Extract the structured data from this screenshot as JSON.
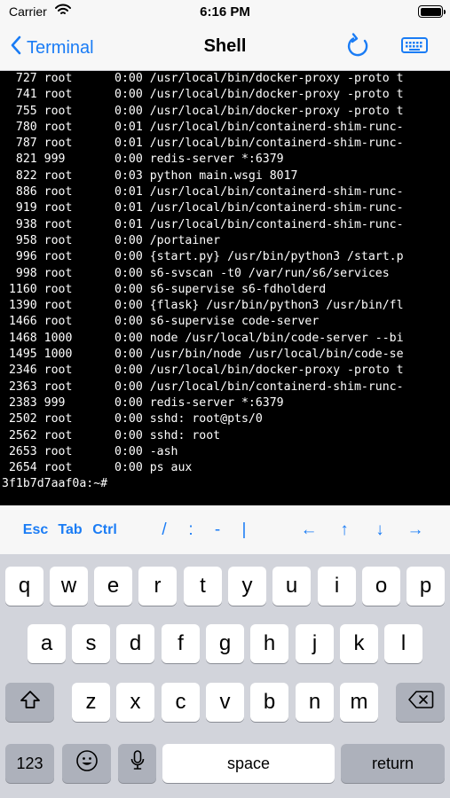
{
  "status_bar": {
    "carrier": "Carrier",
    "time": "6:16 PM"
  },
  "nav": {
    "back_label": "Terminal",
    "title": "Shell"
  },
  "terminal": {
    "lines": [
      "  727 root      0:00 /usr/local/bin/docker-proxy -proto t",
      "  741 root      0:00 /usr/local/bin/docker-proxy -proto t",
      "  755 root      0:00 /usr/local/bin/docker-proxy -proto t",
      "  780 root      0:01 /usr/local/bin/containerd-shim-runc-",
      "  787 root      0:01 /usr/local/bin/containerd-shim-runc-",
      "  821 999       0:00 redis-server *:6379",
      "  822 root      0:03 python main.wsgi 8017",
      "  886 root      0:01 /usr/local/bin/containerd-shim-runc-",
      "  919 root      0:01 /usr/local/bin/containerd-shim-runc-",
      "  938 root      0:01 /usr/local/bin/containerd-shim-runc-",
      "  958 root      0:00 /portainer",
      "  996 root      0:00 {start.py} /usr/bin/python3 /start.p",
      "  998 root      0:00 s6-svscan -t0 /var/run/s6/services",
      " 1160 root      0:00 s6-supervise s6-fdholderd",
      " 1390 root      0:00 {flask} /usr/bin/python3 /usr/bin/fl",
      " 1466 root      0:00 s6-supervise code-server",
      " 1468 1000      0:00 node /usr/local/bin/code-server --bi",
      " 1495 1000      0:00 /usr/bin/node /usr/local/bin/code-se",
      " 2346 root      0:00 /usr/local/bin/docker-proxy -proto t",
      " 2363 root      0:00 /usr/local/bin/containerd-shim-runc-",
      " 2383 999       0:00 redis-server *:6379",
      " 2502 root      0:00 sshd: root@pts/0",
      " 2562 root      0:00 sshd: root",
      " 2653 root      0:00 -ash",
      " 2654 root      0:00 ps aux",
      "3f1b7d7aaf0a:~#"
    ]
  },
  "extra_keys": {
    "esc": "Esc",
    "tab": "Tab",
    "ctrl": "Ctrl",
    "slash": "/",
    "colon": ":",
    "dash": "-",
    "pipe": "|",
    "left": "←",
    "up": "↑",
    "down": "↓",
    "right": "→"
  },
  "keyboard": {
    "row1": [
      "q",
      "w",
      "e",
      "r",
      "t",
      "y",
      "u",
      "i",
      "o",
      "p"
    ],
    "row2": [
      "a",
      "s",
      "d",
      "f",
      "g",
      "h",
      "j",
      "k",
      "l"
    ],
    "row3": [
      "z",
      "x",
      "c",
      "v",
      "b",
      "n",
      "m"
    ],
    "numbers": "123",
    "space": "space",
    "return": "return"
  },
  "colors": {
    "accent": "#1a7cf5",
    "terminal_bg": "#000000",
    "terminal_fg": "#ffffff",
    "keyboard_bg": "#d2d4db"
  }
}
